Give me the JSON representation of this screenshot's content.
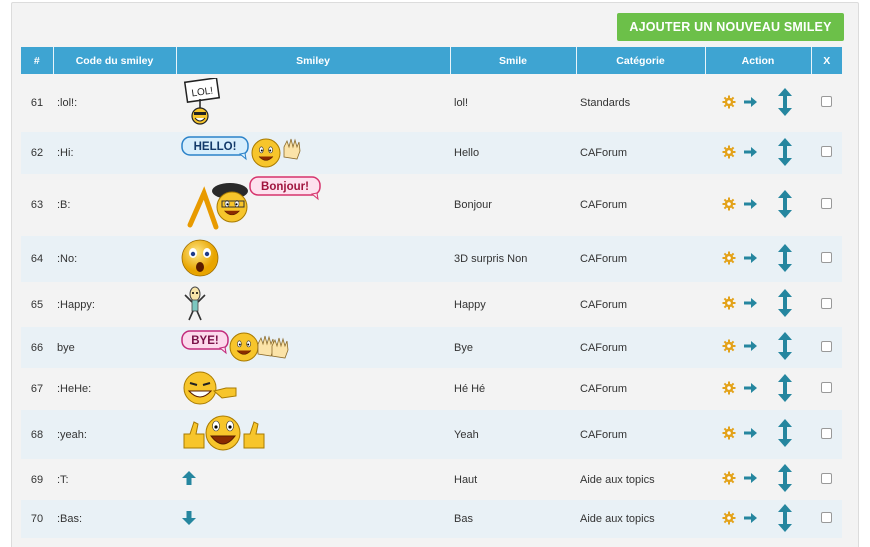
{
  "toolbar": {
    "add_label": "AJOUTER UN NOUVEAU SMILEY"
  },
  "columns": [
    "#",
    "Code du smiley",
    "Smiley",
    "Smile",
    "Catégorie",
    "Action",
    "X"
  ],
  "colors": {
    "header": "#3ea4d2",
    "add_button": "#6cc049",
    "gear": "#e3a21a",
    "arrow": "#25869f"
  },
  "rows": [
    {
      "id": "61",
      "code": ":lol!:",
      "smile": "lol!",
      "category": "Standards",
      "icon": "lol-sign-smiley-icon",
      "sign": "LOL!"
    },
    {
      "id": "62",
      "code": ":Hi:",
      "smile": "Hello",
      "category": "CAForum",
      "icon": "hello-waving-smiley-icon",
      "sign": "HELLO!"
    },
    {
      "id": "63",
      "code": ":B:",
      "smile": "Bonjour",
      "category": "CAForum",
      "icon": "bonjour-beret-smiley-icon",
      "sign": "Bonjour!"
    },
    {
      "id": "64",
      "code": ":No:",
      "smile": "3D surpris Non",
      "category": "CAForum",
      "icon": "surprised-smiley-icon"
    },
    {
      "id": "65",
      "code": ":Happy:",
      "smile": "Happy",
      "category": "CAForum",
      "icon": "dancing-figure-icon"
    },
    {
      "id": "66",
      "code": "bye",
      "smile": "Bye",
      "category": "CAForum",
      "icon": "bye-waving-smiley-icon",
      "sign": "BYE!"
    },
    {
      "id": "67",
      "code": ":HeHe:",
      "smile": "Hé Hé",
      "category": "CAForum",
      "icon": "hehe-winking-smiley-icon"
    },
    {
      "id": "68",
      "code": ":yeah:",
      "smile": "Yeah",
      "category": "CAForum",
      "icon": "thumbs-up-smiley-icon"
    },
    {
      "id": "69",
      "code": ":T:",
      "smile": "Haut",
      "category": "Aide aux topics",
      "icon": "arrow-up-icon"
    },
    {
      "id": "70",
      "code": ":Bas:",
      "smile": "Bas",
      "category": "Aide aux topics",
      "icon": "arrow-down-icon"
    }
  ]
}
